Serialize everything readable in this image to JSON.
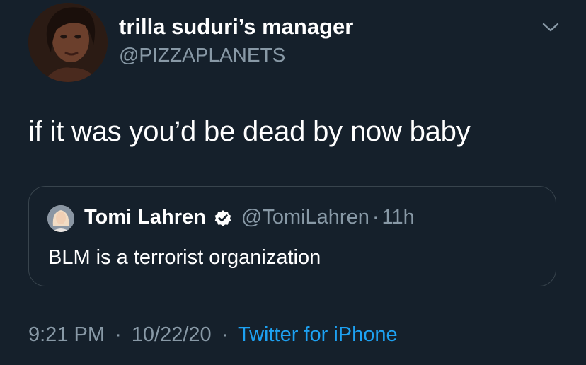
{
  "tweet": {
    "display_name": "trilla suduri’s manager",
    "handle": "@PIZZAPLANETS",
    "text": "if it was you’d be dead by now baby"
  },
  "quoted_tweet": {
    "display_name": "Tomi Lahren",
    "handle": "@TomiLahren",
    "separator": "·",
    "time": "11h",
    "text": "BLM is a terrorist organization",
    "verified": true
  },
  "meta": {
    "time": "9:21 PM",
    "separator": "·",
    "date": "10/22/20",
    "separator2": "·",
    "source": "Twitter for iPhone"
  },
  "colors": {
    "background": "#15202b",
    "primary_text": "#ffffff",
    "secondary_text": "#8899a6",
    "link": "#1da1f2",
    "border": "#38444d"
  },
  "icons": {
    "menu": "chevron-down-icon",
    "verified": "verified-badge-icon"
  }
}
